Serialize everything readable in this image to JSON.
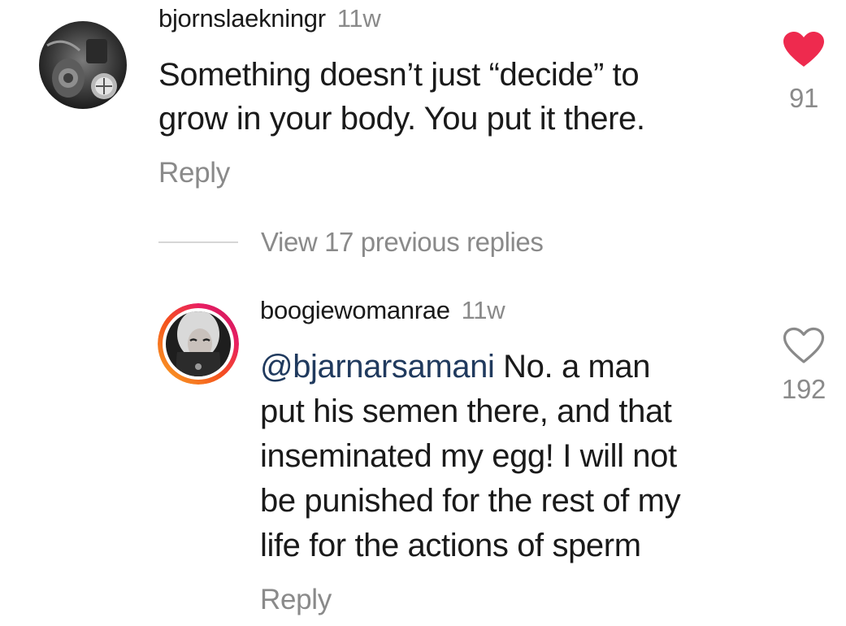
{
  "comments": [
    {
      "username": "bjornslaekningr",
      "timestamp": "11w",
      "text_lines": [
        "Something doesn’t just “decide” to",
        "grow in your body. You put it there."
      ],
      "reply_label": "Reply",
      "likes": "91",
      "liked": true,
      "like_color": "#ee2a4e"
    }
  ],
  "view_replies": {
    "label": "View 17 previous replies"
  },
  "reply": {
    "username": "boogiewomanrae",
    "timestamp": "11w",
    "mention": "@bjarnarsamani",
    "text_first_rest": " No. a man",
    "text_lines": [
      "put his semen there, and that",
      "inseminated my egg! I will not",
      "be punished for the rest of my",
      "life for the actions of sperm"
    ],
    "reply_label": "Reply",
    "likes": "192",
    "liked": false,
    "mention_color": "#203a5e",
    "story_ring_colors": [
      "#f9a825",
      "#e91e63",
      "#c2185b",
      "#e040a0"
    ]
  }
}
